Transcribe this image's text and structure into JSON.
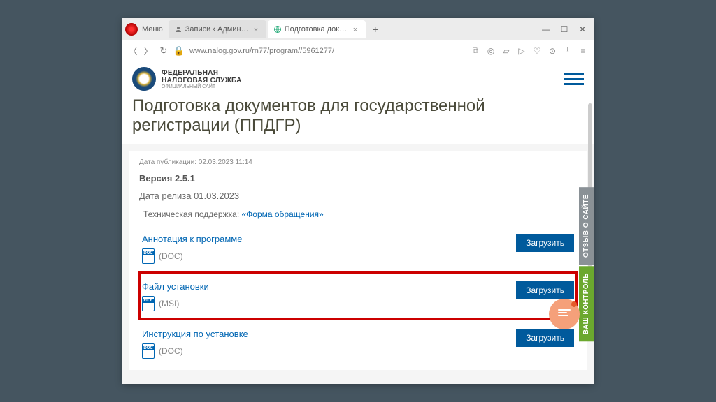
{
  "browser": {
    "menu_label": "Меню",
    "tabs": [
      {
        "title": "Записи ‹ Админкин — W…",
        "active": false
      },
      {
        "title": "Подготовка документов д…",
        "active": true
      }
    ],
    "url": "www.nalog.gov.ru/rn77/program//5961277/"
  },
  "site": {
    "logo_line1": "ФЕДЕРАЛЬНАЯ",
    "logo_line2": "НАЛОГОВАЯ СЛУЖБА",
    "logo_line3": "ОФИЦИАЛЬНЫЙ САЙТ"
  },
  "page": {
    "title": "Подготовка документов для государственной регистрации (ППДГР)",
    "pub_date": "Дата публикации: 02.03.2023 11:14",
    "version": "Версия 2.5.1",
    "release": "Дата релиза 01.03.2023",
    "support_label": "Техническая поддержка: ",
    "support_link": "«Форма обращения»"
  },
  "downloads": [
    {
      "title": "Аннотация к программе",
      "ext": "(DOC)",
      "icon": "DOC",
      "btn": "Загрузить",
      "highlighted": false
    },
    {
      "title": "Файл установки",
      "ext": "(MSI)",
      "icon": "FILE",
      "btn": "Загрузить",
      "highlighted": true
    },
    {
      "title": "Инструкция по установке",
      "ext": "(DOC)",
      "icon": "DOC",
      "btn": "Загрузить",
      "highlighted": false
    }
  ],
  "side": {
    "feedback": "ОТЗЫВ О САЙТЕ",
    "control": "ВАШ КОНТРОЛЬ"
  }
}
